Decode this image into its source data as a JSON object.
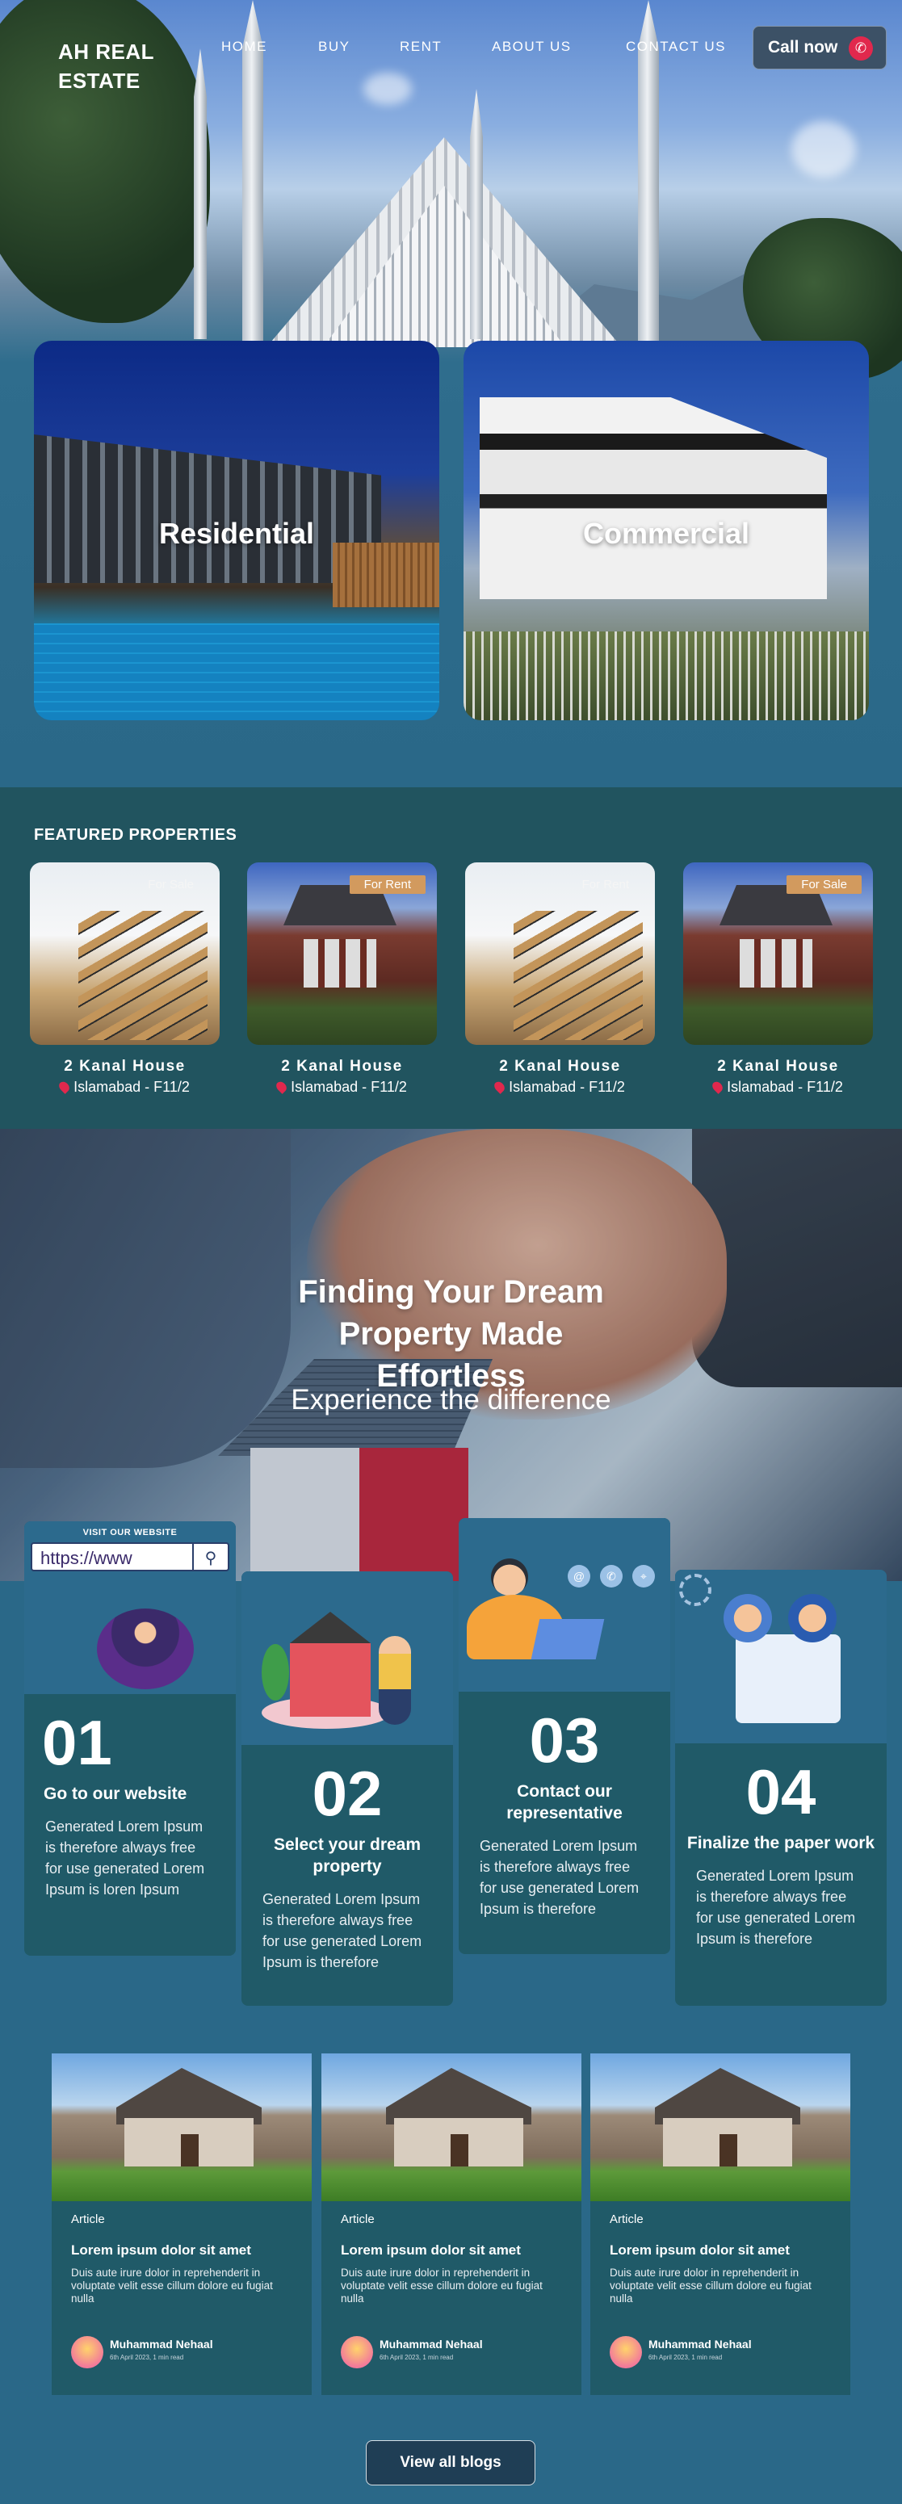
{
  "brand": {
    "logo": "AH REAL ESTATE"
  },
  "nav": {
    "items": [
      "HOME",
      "BUY",
      "RENT",
      "ABOUT US",
      "CONTACT US"
    ],
    "call": "Call now"
  },
  "categories": {
    "residential": "Residential",
    "commercial": "Commercial"
  },
  "featured": {
    "heading": "FEATURED PROPERTIES",
    "items": [
      {
        "tag": "For Sale",
        "title": "2 Kanal House",
        "location": "Islamabad - F11/2"
      },
      {
        "tag": "For Rent",
        "title": "2 Kanal House",
        "location": "Islamabad - F11/2"
      },
      {
        "tag": "For Rent",
        "title": "2 Kanal House",
        "location": "Islamabad - F11/2"
      },
      {
        "tag": "For Sale",
        "title": "2 Kanal House",
        "location": "Islamabad - F11/2"
      }
    ]
  },
  "banner": {
    "heading": "Finding Your Dream Property Made Effortless",
    "sub": "Experience the difference"
  },
  "steps": {
    "browser_caption": "VISIT OUR WEBSITE",
    "browser_url": "https://www",
    "items": [
      {
        "num": "01",
        "title": "Go to our website",
        "body": "Generated Lorem Ipsum is therefore always free for use generated Lorem Ipsum is loren Ipsum"
      },
      {
        "num": "02",
        "title": "Select your dream property",
        "body": "Generated Lorem Ipsum is therefore always free for use generated Lorem Ipsum is therefore"
      },
      {
        "num": "03",
        "title": "Contact our representative",
        "body": "Generated Lorem Ipsum is therefore always free for use generated Lorem Ipsum is therefore"
      },
      {
        "num": "04",
        "title": "Finalize the paper work",
        "body": "Generated Lorem Ipsum is therefore always free for use generated Lorem Ipsum is therefore"
      }
    ]
  },
  "blogs": {
    "items": [
      {
        "category": "Article",
        "title": "Lorem ipsum dolor sit amet",
        "excerpt": "Duis aute irure dolor in reprehenderit in voluptate velit esse cillum dolore eu fugiat nulla",
        "author": "Muhammad Nehaal",
        "meta": "6th April 2023, 1 min read"
      },
      {
        "category": "Article",
        "title": "Lorem ipsum dolor sit amet",
        "excerpt": "Duis aute irure dolor in reprehenderit in voluptate velit esse cillum dolore eu fugiat nulla",
        "author": "Muhammad Nehaal",
        "meta": "6th April 2023, 1 min read"
      },
      {
        "category": "Article",
        "title": "Lorem ipsum dolor sit amet",
        "excerpt": "Duis aute irure dolor in reprehenderit in voluptate velit esse cillum dolore eu fugiat nulla",
        "author": "Muhammad Nehaal",
        "meta": "6th April 2023, 1 min read"
      }
    ],
    "view_all": "View all blogs"
  },
  "colors": {
    "accent_red": "#e1284d",
    "tag_rent": "#d29a5e",
    "page_bg": "#2a6888",
    "section_dark": "#21545f"
  }
}
